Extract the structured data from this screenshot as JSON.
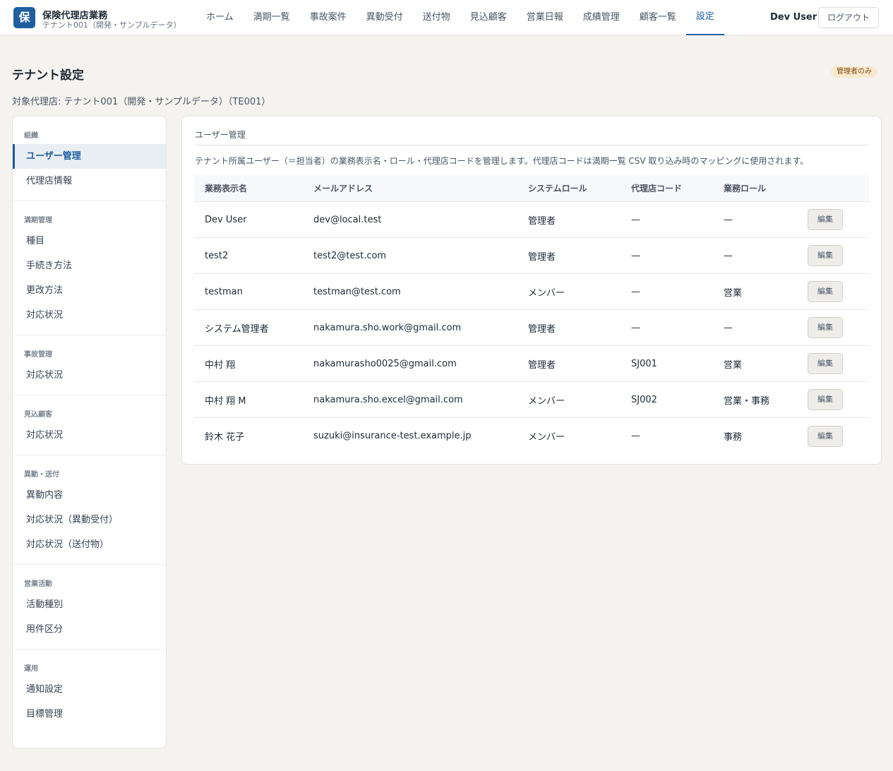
{
  "header": {
    "logo_char": "保",
    "app_title": "保険代理店業務",
    "tenant_sub": "テナント001（開発・サンプルデータ）",
    "nav": [
      {
        "label": "ホーム"
      },
      {
        "label": "満期一覧"
      },
      {
        "label": "事故案件"
      },
      {
        "label": "異動受付"
      },
      {
        "label": "送付物"
      },
      {
        "label": "見込顧客"
      },
      {
        "label": "営業日報"
      },
      {
        "label": "成績管理"
      },
      {
        "label": "顧客一覧"
      },
      {
        "label": "設定",
        "active": true
      }
    ],
    "user_name": "Dev User",
    "logout_label": "ログアウト"
  },
  "page": {
    "title": "テナント設定",
    "admin_badge": "管理者のみ",
    "target_agency": "対象代理店: テナント001（開発・サンプルデータ）（TE001）"
  },
  "sidebar": {
    "groups": [
      {
        "heading": "組織",
        "items": [
          "ユーザー管理",
          "代理店情報"
        ]
      },
      {
        "heading": "満期管理",
        "items": [
          "種目",
          "手続き方法",
          "更改方法",
          "対応状況"
        ]
      },
      {
        "heading": "事故管理",
        "items": [
          "対応状況"
        ]
      },
      {
        "heading": "見込顧客",
        "items": [
          "対応状況"
        ]
      },
      {
        "heading": "異動・送付",
        "items": [
          "異動内容",
          "対応状況（異動受付）",
          "対応状況（送付物）"
        ]
      },
      {
        "heading": "営業活動",
        "items": [
          "活動種別",
          "用件区分"
        ]
      },
      {
        "heading": "運用",
        "items": [
          "通知設定",
          "目標管理"
        ]
      }
    ],
    "active_item": "ユーザー管理"
  },
  "main": {
    "section_title": "ユーザー管理",
    "description": "テナント所属ユーザー（＝担当者）の業務表示名・ロール・代理店コードを管理します。代理店コードは満期一覧 CSV 取り込み時のマッピングに使用されます。",
    "columns": [
      "業務表示名",
      "メールアドレス",
      "システムロール",
      "代理店コード",
      "業務ロール",
      ""
    ],
    "edit_label": "編集",
    "rows": [
      [
        "Dev User",
        "dev@local.test",
        "管理者",
        "—",
        "—"
      ],
      [
        "test2",
        "test2@test.com",
        "管理者",
        "—",
        "—"
      ],
      [
        "testman",
        "testman@test.com",
        "メンバー",
        "—",
        "営業"
      ],
      [
        "システム管理者",
        "nakamura.sho.work@gmail.com",
        "管理者",
        "—",
        "—"
      ],
      [
        "中村 翔",
        "nakamurasho0025@gmail.com",
        "管理者",
        "SJ001",
        "営業"
      ],
      [
        "中村 翔 M",
        "nakamura.sho.excel@gmail.com",
        "メンバー",
        "SJ002",
        "営業・事務"
      ],
      [
        "鈴木 花子",
        "suzuki@insurance-test.example.jp",
        "メンバー",
        "—",
        "事務"
      ]
    ]
  },
  "colors": {
    "accent": "#1f5fa0",
    "background": "#f4f3ef",
    "badge_bg": "#fbe9cf"
  }
}
